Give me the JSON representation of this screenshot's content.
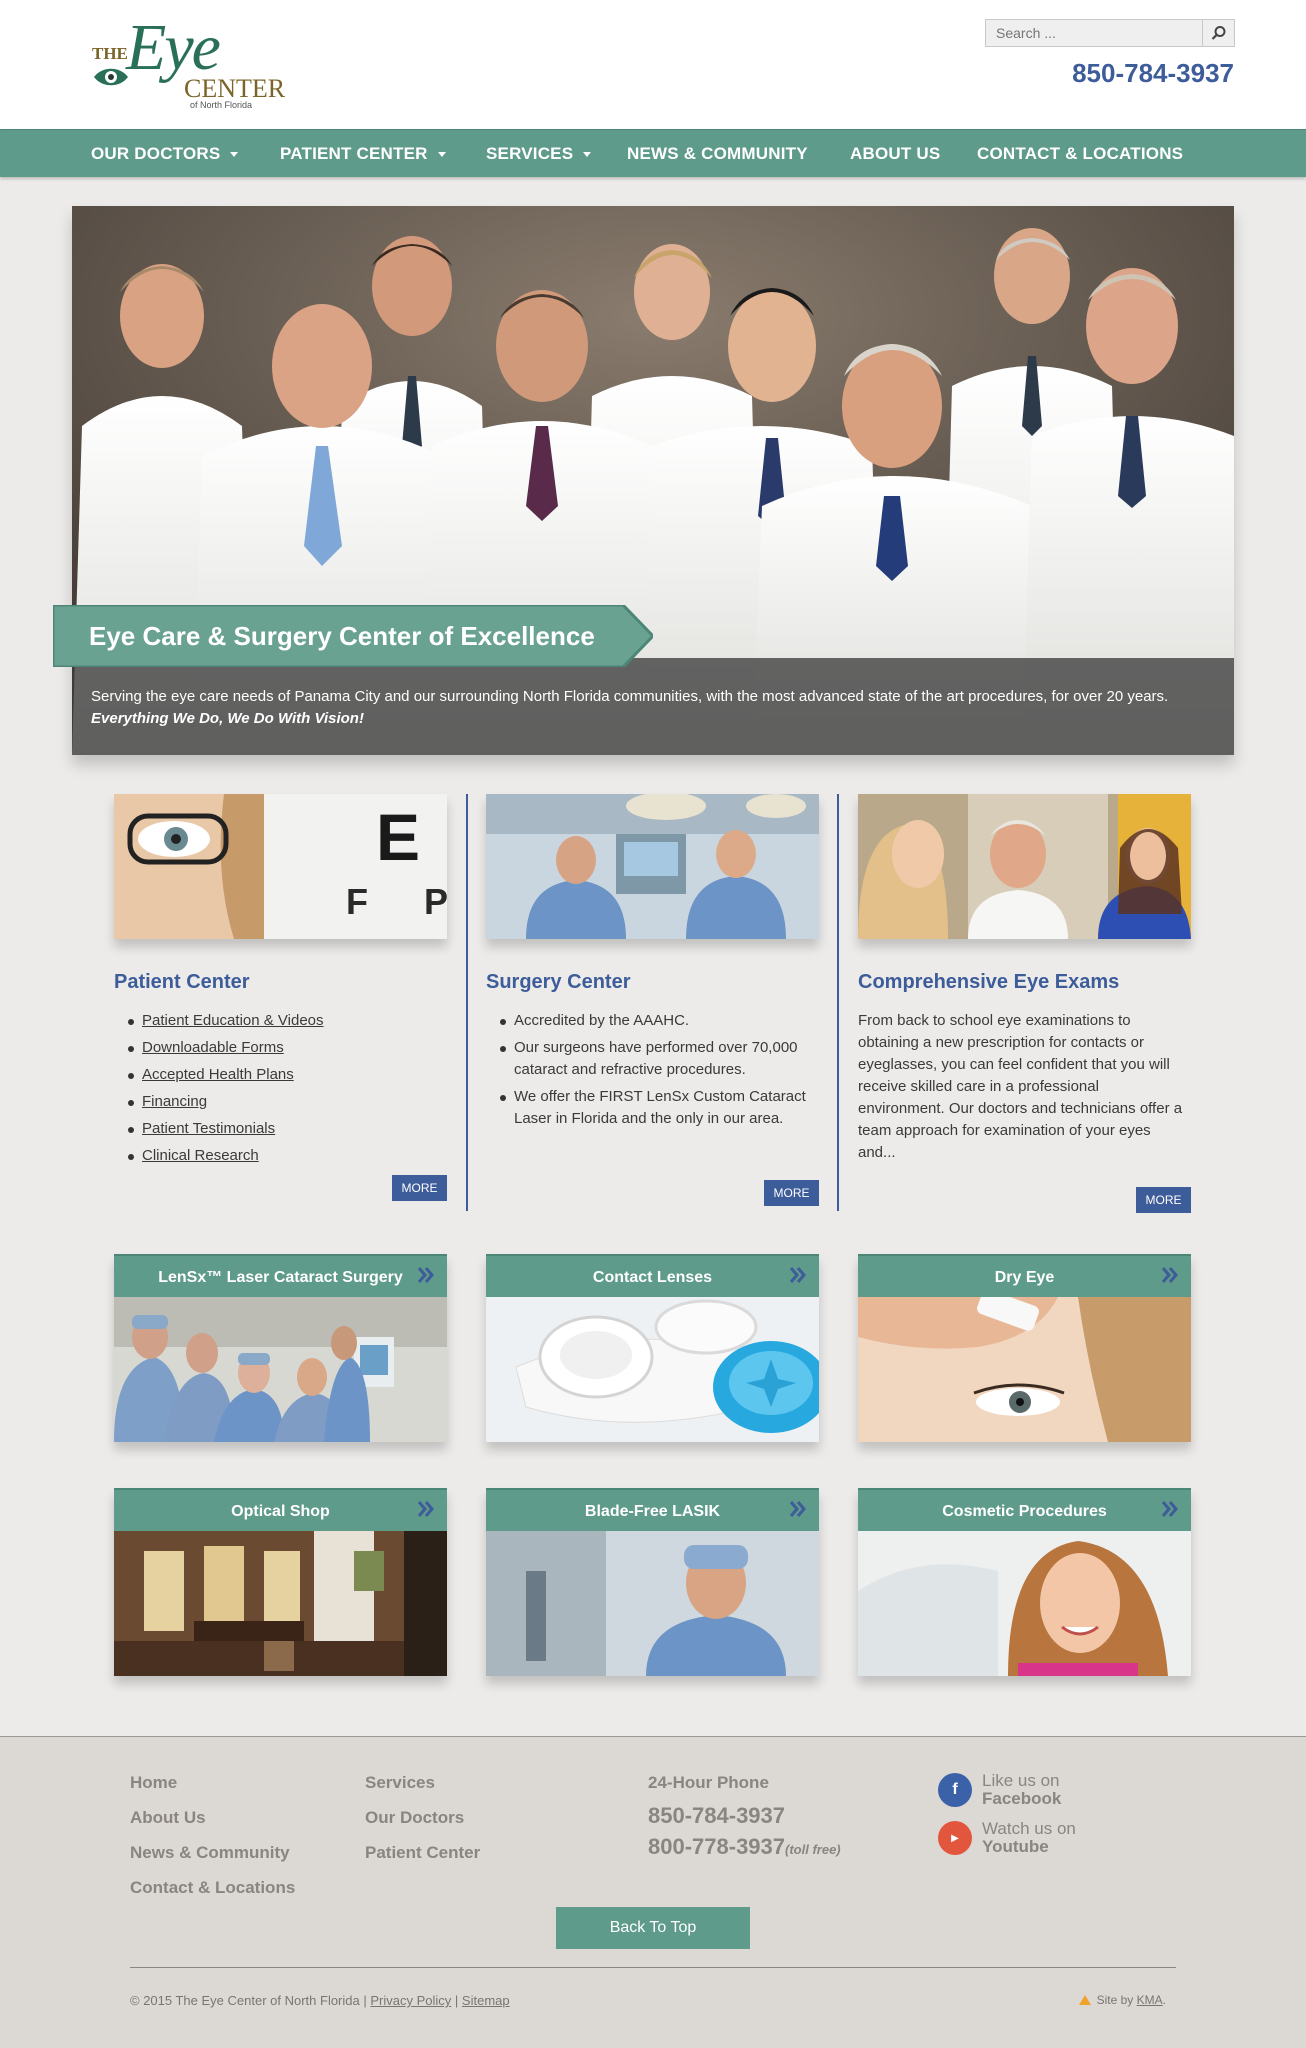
{
  "header": {
    "logo_the": "THE",
    "logo_eye": "Eye",
    "logo_center": "CENTER",
    "logo_sub": "of North Florida",
    "search_placeholder": "Search ...",
    "phone": "850-784-3937"
  },
  "nav": [
    {
      "label": "OUR DOCTORS",
      "has_dropdown": true
    },
    {
      "label": "PATIENT CENTER",
      "has_dropdown": true
    },
    {
      "label": "SERVICES",
      "has_dropdown": true
    },
    {
      "label": "NEWS & COMMUNITY",
      "has_dropdown": false
    },
    {
      "label": "ABOUT US",
      "has_dropdown": false
    },
    {
      "label": "CONTACT & LOCATIONS",
      "has_dropdown": false
    }
  ],
  "hero": {
    "title": "Eye Care & Surgery Center of Excellence",
    "text": "Serving the eye care needs of Panama City and our surrounding North Florida communities, with the most advanced state of the art procedures, for over 20 years.",
    "tagline": "Everything We Do, We Do With Vision!"
  },
  "columns": [
    {
      "title": "Patient Center",
      "items": [
        "Patient Education & Videos",
        "Downloadable Forms",
        "Accepted Health Plans",
        "Financing",
        "Patient Testimonials",
        "Clinical Research"
      ],
      "more": "MORE"
    },
    {
      "title": "Surgery Center",
      "items": [
        "Accredited by the AAAHC.",
        "Our surgeons have performed over 70,000 cataract and refractive procedures.",
        "We offer the FIRST LenSx Custom Cataract Laser in Florida and the only in our area."
      ],
      "more": "MORE"
    },
    {
      "title": "Comprehensive Eye Exams",
      "text": "From back to school eye examinations to obtaining a new prescription for contacts or eyeglasses, you can feel confident that you will receive skilled care in a professional environment. Our doctors and technicians offer a team approach for examination of your eyes and...",
      "more": "MORE"
    }
  ],
  "tiles": [
    {
      "label": "LenSx™ Laser Cataract Surgery"
    },
    {
      "label": "Contact Lenses"
    },
    {
      "label": "Dry Eye"
    },
    {
      "label": "Optical Shop"
    },
    {
      "label": "Blade-Free LASIK"
    },
    {
      "label": "Cosmetic Procedures"
    }
  ],
  "footer": {
    "links_col1": [
      "Home",
      "About Us",
      "News & Community",
      "Contact & Locations"
    ],
    "links_col2": [
      "Services",
      "Our Doctors",
      "Patient Center"
    ],
    "phone_label": "24-Hour Phone",
    "phone1": "850-784-3937",
    "phone2": "800-778-3937",
    "phone2_note": "(toll free)",
    "social": [
      {
        "line1": "Like us on",
        "line2": "Facebook",
        "icon": "facebook-icon",
        "color": "#3b62a8"
      },
      {
        "line1": "Watch us on",
        "line2": "Youtube",
        "icon": "youtube-icon",
        "color": "#e2563e"
      }
    ],
    "back_to_top": "Back To Top",
    "copyright": "© 2015 The Eye Center of North Florida |",
    "privacy": "Privacy Policy",
    "sep": "|",
    "sitemap": "Sitemap",
    "site_by": "Site by",
    "site_by_link": "KMA",
    "site_by_end": "."
  },
  "colors": {
    "teal": "#5f9b8a",
    "blue": "#3d5c9a",
    "footer_bg": "#dcd8d4"
  }
}
